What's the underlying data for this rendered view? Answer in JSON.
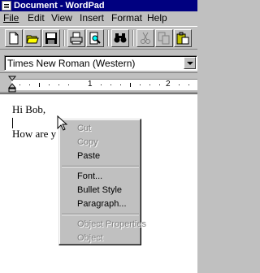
{
  "window": {
    "title": "Document - WordPad"
  },
  "menu": {
    "items": [
      {
        "label": "File"
      },
      {
        "label": "Edit"
      },
      {
        "label": "View"
      },
      {
        "label": "Insert"
      },
      {
        "label": "Format"
      },
      {
        "label": "Help"
      }
    ]
  },
  "toolbar": {
    "buttons": [
      "new-document-icon",
      "open-folder-icon",
      "save-disk-icon",
      "print-icon",
      "print-preview-icon",
      "find-binoculars-icon",
      "cut-scissors-icon",
      "copy-icon",
      "paste-icon"
    ]
  },
  "format_bar": {
    "font_name": "Times New Roman (Western)"
  },
  "ruler": {
    "numbers": [
      "1",
      "2"
    ]
  },
  "document": {
    "lines": [
      "Hi Bob,",
      "",
      "How are y"
    ]
  },
  "context_menu": {
    "items": [
      {
        "label": "Cut",
        "enabled": false
      },
      {
        "label": "Copy",
        "enabled": false
      },
      {
        "label": "Paste",
        "enabled": true
      },
      {
        "label": "Font...",
        "enabled": true
      },
      {
        "label": "Bullet Style",
        "enabled": true
      },
      {
        "label": "Paragraph...",
        "enabled": true
      },
      {
        "label": "Object Properties",
        "enabled": false
      },
      {
        "label": "Object",
        "enabled": false
      }
    ]
  },
  "colors": {
    "title_bar": "#000080",
    "face": "#c0c0c0",
    "disabled_text": "#808080"
  }
}
